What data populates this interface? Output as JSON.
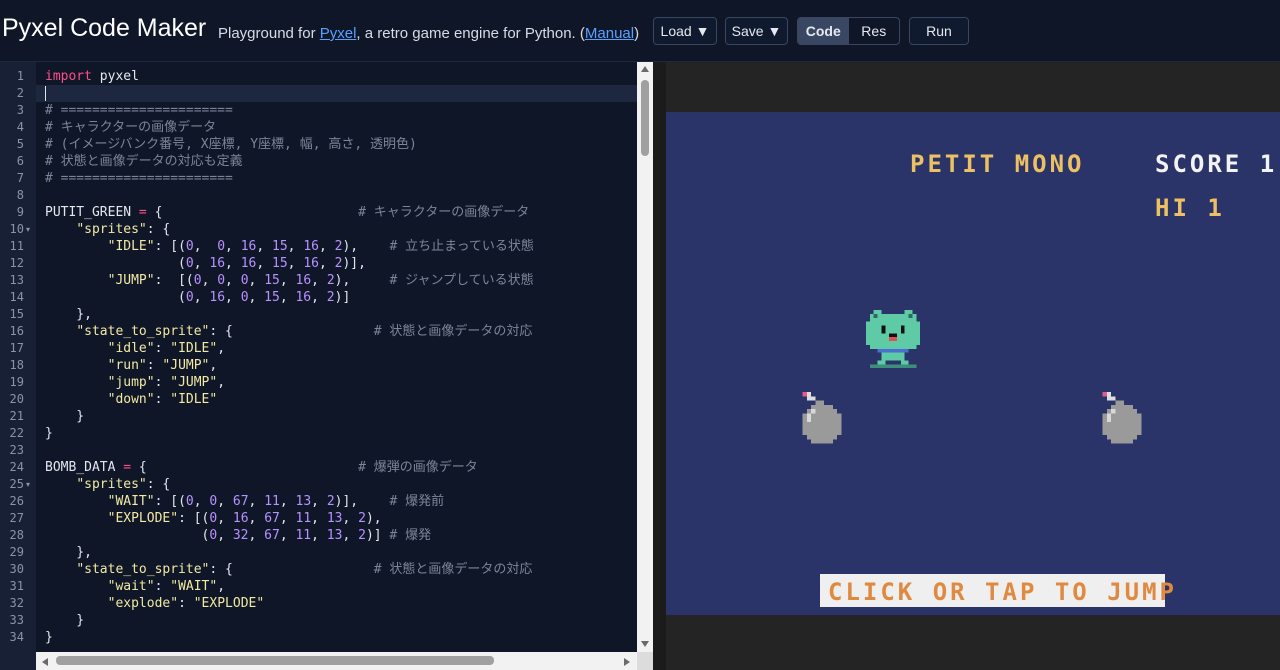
{
  "header": {
    "title": "Pyxel Code Maker",
    "tagline_prefix": "Playground for ",
    "tagline_link": "Pyxel",
    "tagline_middle": ", a retro game engine for Python. (",
    "manual_link": "Manual",
    "tagline_suffix": ")",
    "load_label": "Load ▼",
    "save_label": "Save ▼",
    "code_label": "Code",
    "res_label": "Res",
    "run_label": "Run",
    "active_mode": "Code"
  },
  "editor": {
    "line_numbers": [
      "1",
      "2",
      "3",
      "4",
      "5",
      "6",
      "7",
      "8",
      "9",
      "10",
      "11",
      "12",
      "13",
      "14",
      "15",
      "16",
      "17",
      "18",
      "19",
      "20",
      "21",
      "22",
      "23",
      "24",
      "25",
      "26",
      "27",
      "28",
      "29",
      "30",
      "31",
      "32",
      "33",
      "34"
    ],
    "fold_lines": [
      "10",
      "25"
    ],
    "active_line": 2,
    "lines": [
      "import pyxel",
      "",
      "# ======================",
      "# キャラクターの画像データ",
      "# (イメージバンク番号, X座標, Y座標, 幅, 高さ, 透明色)",
      "# 状態と画像データの対応も定義",
      "# ======================",
      "",
      "PUTIT_GREEN = {                         # キャラクターの画像データ",
      "    \"sprites\": {",
      "        \"IDLE\": [(0,  0, 16, 15, 16, 2),    # 立ち止まっている状態",
      "                 (0, 16, 16, 15, 16, 2)],",
      "        \"JUMP\":  [(0, 0, 0, 15, 16, 2),     # ジャンプしている状態",
      "                 (0, 16, 0, 15, 16, 2)]",
      "    },",
      "    \"state_to_sprite\": {                  # 状態と画像データの対応",
      "        \"idle\": \"IDLE\",",
      "        \"run\": \"JUMP\",",
      "        \"jump\": \"JUMP\",",
      "        \"down\": \"IDLE\"",
      "    }",
      "}",
      "",
      "BOMB_DATA = {                           # 爆弾の画像データ",
      "    \"sprites\": {",
      "        \"WAIT\": [(0, 0, 67, 11, 13, 2)],    # 爆発前",
      "        \"EXPLODE\": [(0, 16, 67, 11, 13, 2),",
      "                    (0, 32, 67, 11, 13, 2)] # 爆発",
      "    },",
      "    \"state_to_sprite\": {                  # 状態と画像データの対応",
      "        \"wait\": \"WAIT\",",
      "        \"explode\": \"EXPLODE\"",
      "    }",
      "}"
    ]
  },
  "game": {
    "title_text": "PETIT MONO",
    "score_text": "SCORE 1",
    "hi_text": "HI 1",
    "prompt_text": "CLICK OR TAP TO JUMP",
    "colors": {
      "background": "#2a3468",
      "title": "#ecc063",
      "score": "#f3f3f3",
      "prompt": "#e08940",
      "character": "#5fcaa6",
      "bomb": "#9a9a9a"
    },
    "sprites": [
      "putit-green-character",
      "bomb-left",
      "bomb-right"
    ]
  }
}
